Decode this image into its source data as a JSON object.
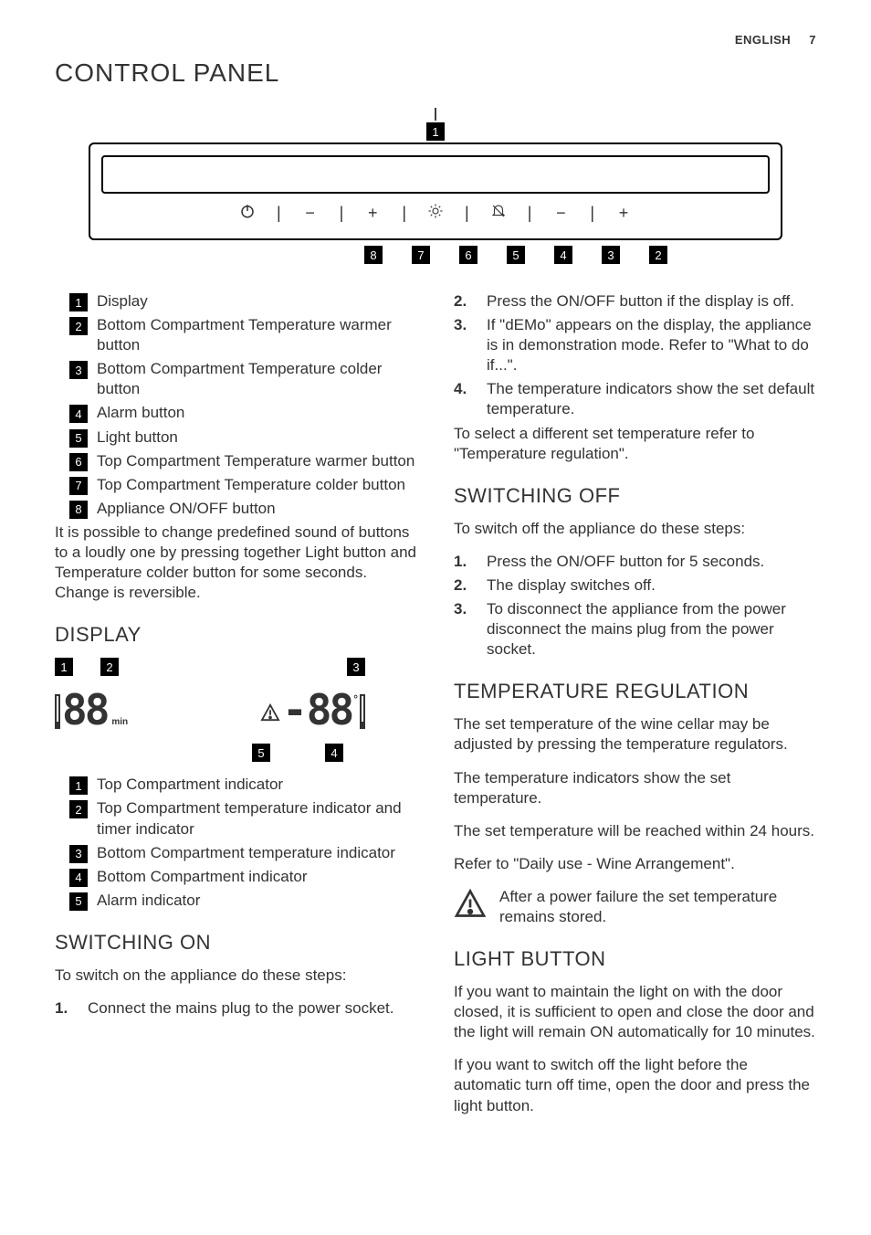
{
  "header": {
    "language": "ENGLISH",
    "page": "7"
  },
  "title": "CONTROL PANEL",
  "panel": {
    "callouts_top": [
      "1"
    ],
    "buttons": {
      "power": "⏻",
      "minus1": "−",
      "plus1": "+",
      "light": "☀",
      "alarm": "🔕",
      "minus2": "−",
      "plus2": "+"
    },
    "callouts_bottom": [
      "8",
      "7",
      "6",
      "5",
      "4",
      "3",
      "2"
    ]
  },
  "legend": [
    {
      "n": "1",
      "label": "Display"
    },
    {
      "n": "2",
      "label": "Bottom Compartment Temperature warmer button"
    },
    {
      "n": "3",
      "label": "Bottom Compartment Temperature colder button"
    },
    {
      "n": "4",
      "label": "Alarm button"
    },
    {
      "n": "5",
      "label": "Light button"
    },
    {
      "n": "6",
      "label": "Top Compartment Temperature warmer button"
    },
    {
      "n": "7",
      "label": "Top Compartment Temperature colder button"
    },
    {
      "n": "8",
      "label": "Appliance ON/OFF button"
    }
  ],
  "legend_note": "It is possible to change predefined sound of buttons to a loudly one by pressing together Light button and Temperature colder button for some seconds. Change is reversible.",
  "display_heading": "DISPLAY",
  "display": {
    "top_markers": [
      "1",
      "2",
      "3"
    ],
    "left_digits": "88",
    "min": "min",
    "warning_icon": "⚠",
    "right_prefix": "-",
    "right_digits": "88",
    "deg": "°",
    "bottom_markers": [
      "5",
      "4"
    ]
  },
  "display_legend": [
    {
      "n": "1",
      "label": "Top Compartment indicator"
    },
    {
      "n": "2",
      "label": "Top Compartment temperature indicator and timer indicator"
    },
    {
      "n": "3",
      "label": "Bottom Compartment temperature indicator"
    },
    {
      "n": "4",
      "label": "Bottom Compartment indicator"
    },
    {
      "n": "5",
      "label": "Alarm indicator"
    }
  ],
  "switching_on": {
    "heading": "SWITCHING ON",
    "intro": "To switch on the appliance do these steps:",
    "steps_a": [
      "Connect the mains plug to the power socket."
    ],
    "steps_b": [
      "Press the ON/OFF button if the display is off.",
      "If \"dEMo\" appears on the display, the appliance is in demonstration mode. Refer to \"What to do if...\".",
      "The temperature indicators show the set default temperature."
    ],
    "outro": "To select a different set temperature refer to \"Temperature regulation\"."
  },
  "switching_off": {
    "heading": "SWITCHING OFF",
    "intro": "To switch off the appliance do these steps:",
    "steps": [
      "Press the ON/OFF button for 5 seconds.",
      "The display switches off.",
      "To disconnect the appliance from the power disconnect the mains plug from the power socket."
    ]
  },
  "temp_reg": {
    "heading": "TEMPERATURE REGULATION",
    "p1": "The set temperature of the wine cellar may be adjusted by pressing the temperature regulators.",
    "p2": "The temperature indicators show the set temperature.",
    "p3": "The set temperature will be reached within 24 hours.",
    "p4": "Refer to \"Daily use - Wine Arrangement\".",
    "note": "After a power failure the set temperature remains stored."
  },
  "light_btn": {
    "heading": "LIGHT BUTTON",
    "p1": "If you want to maintain the light on with the door closed, it is sufficient to open and close the door and the light will remain ON automatically for 10 minutes.",
    "p2": "If you want to switch off the light before the automatic turn off time, open the door and press the light button."
  }
}
